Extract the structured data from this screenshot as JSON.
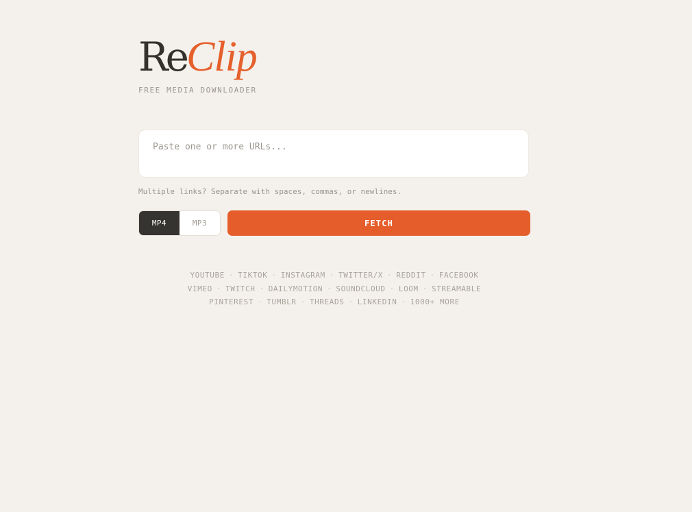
{
  "brand": {
    "name_part1": "Re",
    "name_part2": "Clip",
    "tagline": "FREE MEDIA DOWNLOADER"
  },
  "url_input": {
    "placeholder": "Paste one or more URLs...",
    "value": ""
  },
  "hint": "Multiple links? Separate with spaces, commas, or newlines.",
  "format_toggle": {
    "options": [
      "MP4",
      "MP3"
    ],
    "selected": "MP4"
  },
  "fetch_button": {
    "label": "FETCH"
  },
  "platforms": {
    "separator": "·",
    "lines": [
      [
        "YOUTUBE",
        "TIKTOK",
        "INSTAGRAM",
        "TWITTER/X",
        "REDDIT",
        "FACEBOOK"
      ],
      [
        "VIMEO",
        "TWITCH",
        "DAILYMOTION",
        "SOUNDCLOUD",
        "LOOM",
        "STREAMABLE"
      ],
      [
        "PINTEREST",
        "TUMBLR",
        "THREADS",
        "LINKEDIN",
        "1000+ MORE"
      ]
    ]
  },
  "colors": {
    "background": "#f4f1ec",
    "accent": "#e55d2b",
    "dark": "#363431",
    "muted_text": "#9a958e"
  }
}
